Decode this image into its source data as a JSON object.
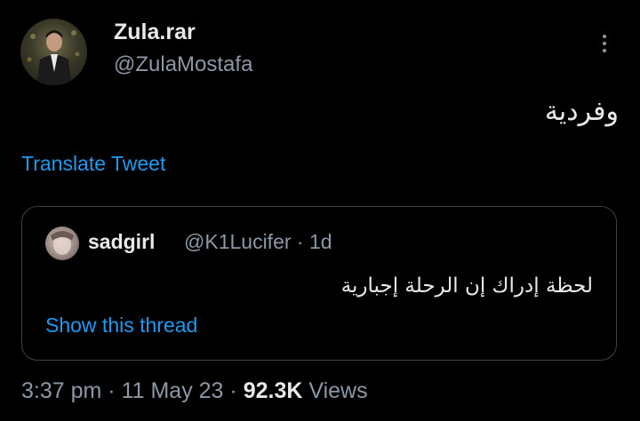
{
  "author": {
    "name": "Zula.rar",
    "handle": "@ZulaMostafa"
  },
  "tweet": {
    "text": "وفردية",
    "translate_label": "Translate Tweet"
  },
  "quoted_tweet": {
    "name": "sadgirl",
    "handle": "@K1Lucifer",
    "separator": "·",
    "age": "1d",
    "text": "لحظة إدراك إن الرحلة إجبارية",
    "show_thread_label": "Show this thread"
  },
  "footer": {
    "time": "3:37 pm",
    "sep1": "·",
    "date": "11 May 23",
    "sep2": "·",
    "views_count": "92.3K",
    "views_label": "Views"
  },
  "icons": {
    "more": "more-vertical-icon"
  },
  "colors": {
    "background": "#000000",
    "text": "#e7e9ea",
    "secondary": "#8b98a5",
    "link": "#1d9bf0",
    "border": "#3e4144"
  }
}
